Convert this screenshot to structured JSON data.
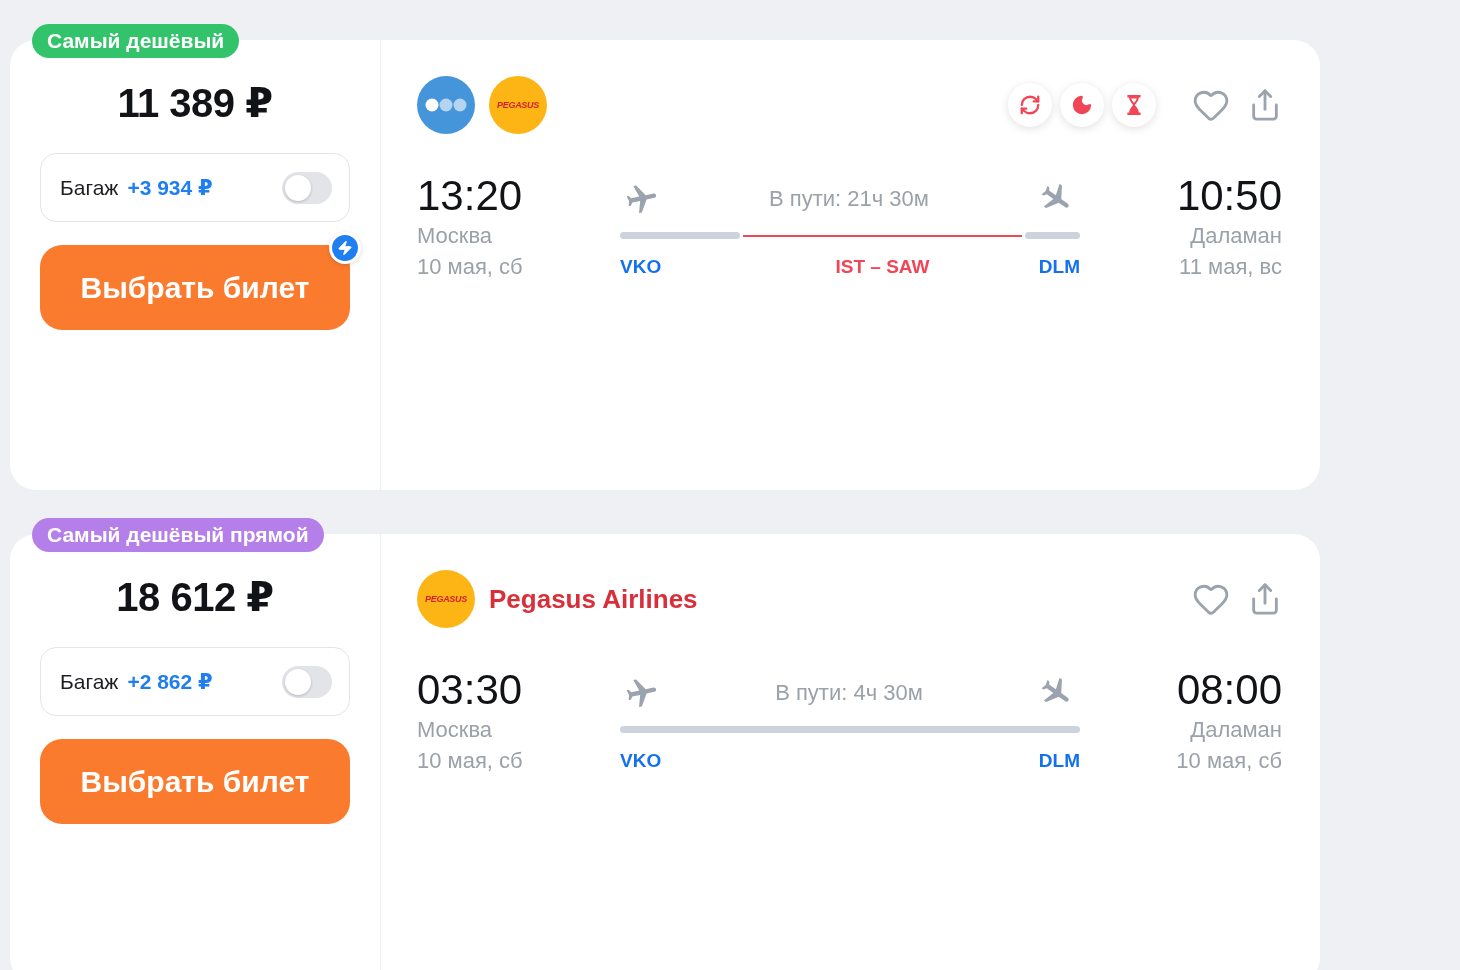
{
  "offers": [
    {
      "badge": {
        "text": "Самый дешёвый",
        "color": "#33c46b"
      },
      "price": "11 389 ₽",
      "baggage": {
        "label": "Багаж",
        "price": "+3 934 ₽",
        "on": false
      },
      "button": "Выбрать билет",
      "fast_booking": true,
      "airlines": [
        {
          "kind": "dots"
        },
        {
          "kind": "pegasus",
          "logo_text": "PEGASUS"
        }
      ],
      "features": [
        {
          "kind": "airport_change"
        },
        {
          "kind": "overnight"
        },
        {
          "kind": "long_layover"
        }
      ],
      "favorite": false,
      "departure": {
        "time": "13:20",
        "city": "Москва",
        "date": "10 мая, сб",
        "airport": "VKO"
      },
      "duration": "В пути: 21ч 30м",
      "segments": [
        {
          "kind": "flight"
        },
        {
          "kind": "transfer",
          "label": "IST – SAW"
        },
        {
          "kind": "flight"
        }
      ],
      "arrival": {
        "time": "10:50",
        "city": "Даламан",
        "date": "11 мая, вс",
        "airport": "DLM"
      }
    },
    {
      "badge": {
        "text": "Самый дешёвый прямой",
        "color": "#b57fe9"
      },
      "price": "18 612 ₽",
      "baggage": {
        "label": "Багаж",
        "price": "+2 862 ₽",
        "on": false
      },
      "button": "Выбрать билет",
      "fast_booking": false,
      "airlines": [
        {
          "kind": "pegasus",
          "logo_text": "PEGASUS",
          "name": "Pegasus Airlines"
        }
      ],
      "favorite": false,
      "departure": {
        "time": "03:30",
        "city": "Москва",
        "date": "10 мая, сб",
        "airport": "VKO"
      },
      "duration": "В пути: 4ч 30м",
      "segments": [
        {
          "kind": "flight"
        }
      ],
      "arrival": {
        "time": "08:00",
        "city": "Даламан",
        "date": "10 мая, сб",
        "airport": "DLM"
      }
    }
  ]
}
